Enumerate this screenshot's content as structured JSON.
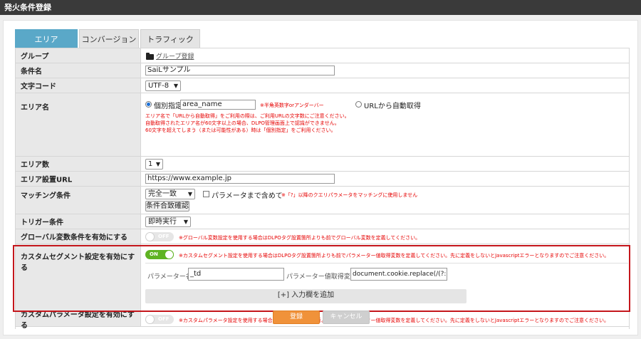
{
  "window": {
    "title": "発火条件登録"
  },
  "tabs": [
    {
      "label": "エリア"
    },
    {
      "label": "コンバージョン"
    },
    {
      "label": "トラフィック"
    }
  ],
  "rows": {
    "group": {
      "label": "グループ",
      "link": "グループ登録"
    },
    "condition_name": {
      "label": "条件名",
      "value": "SaiLサンプル"
    },
    "charset": {
      "label": "文字コード",
      "selected": "UTF-8"
    },
    "area_name": {
      "label": "エリア名",
      "radio_individual": "個別指定",
      "input_value": "area_name",
      "input_note": "※半角英数字orアンダーバー",
      "radio_auto": "URLから自動取得",
      "notes": [
        "エリア名で「URLから自動取得」をご利用の際は、ご利用URLの文字数にご注意ください。",
        "自動取得されたエリア名が60文字以上の場合、DLPO管理画面上で認識ができません。",
        "60文字を超えてしまう（または可能性がある）時は「個別指定」をご利用ください。"
      ]
    },
    "area_count": {
      "label": "エリア数",
      "selected": "1"
    },
    "area_url": {
      "label": "エリア設置URL",
      "value": "https://www.example.jp"
    },
    "matching": {
      "label": "マッチング条件",
      "selected": "完全一致",
      "checkbox_label": "パラメータまで含めて",
      "note": "※「?」以降のクエリパラメータをマッチングに使用しません",
      "button": "条件合致確認"
    },
    "trigger": {
      "label": "トリガー条件",
      "selected": "即時実行"
    },
    "global_var": {
      "label": "グローバル変数条件を有効にする",
      "toggle": "OFF",
      "note": "※グローバル変数設定を使用する場合はDLPOタグ設置箇所よりも前でグローバル変数を定義してください。"
    },
    "custom_segment": {
      "label": "カスタムセグメント設定を有効にする",
      "toggle": "ON",
      "note": "※カスタムセグメント設定を使用する場合はDLPOタグ設置箇所よりも前でパラメーター値取得変数を定義してください。先に定義をしないとJavascriptエラーとなりますのでご注意ください。",
      "param_name_label": "パラメーター名",
      "param_name_value": "_td",
      "param_var_label": "パラメーター値取得変数",
      "param_var_value": "document.cookie.replace(/(?:(?:^|.*;\\s*",
      "add_button": "[+] 入力欄を追加"
    },
    "custom_param": {
      "label": "カスタムパラメータ設定を有効にする",
      "toggle": "OFF",
      "note": "※カスタムパラメータ設定を使用する場合はDLPOタグ設置箇所よりも前でパラメーター値取得変数を定義してください。先に定義をしないとJavascriptエラーとなりますのでご注意ください。"
    }
  },
  "footer": {
    "submit": "登録",
    "cancel": "キャンセル"
  },
  "colors": {
    "accent_tab": "#5aa8c8",
    "submit": "#f0923a",
    "highlight": "#c4161c",
    "toggle_on": "#5fb323",
    "note_red": "#e60000"
  }
}
